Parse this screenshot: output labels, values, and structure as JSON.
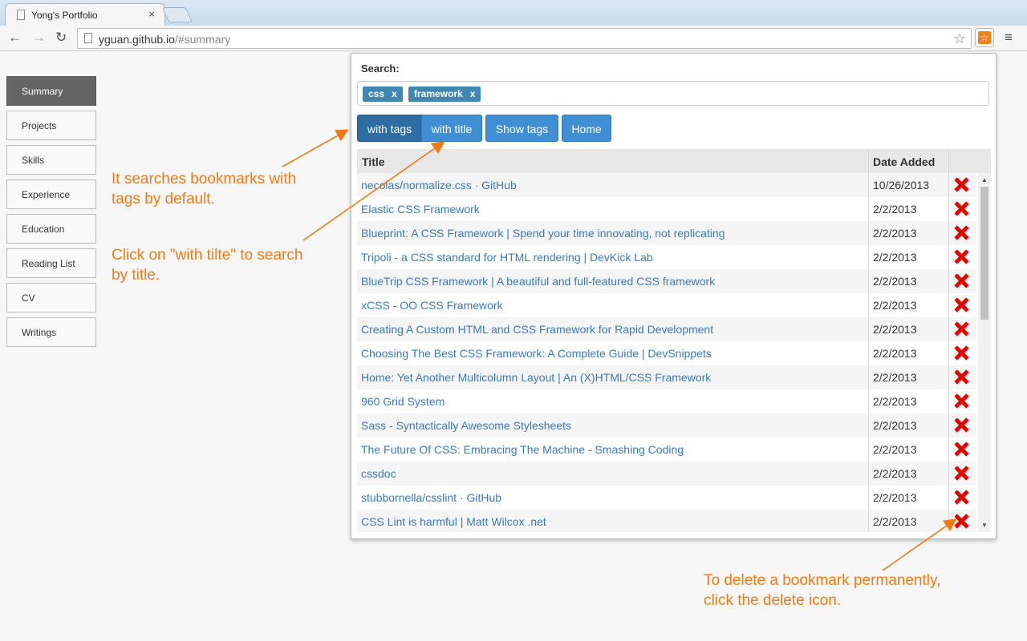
{
  "browser": {
    "tab_title": "Yong's Portfolio",
    "tab_close": "×",
    "url_host": "yguan.github.io",
    "url_path": "/#summary",
    "ext_icon": "☆",
    "menu_glyph": "≡"
  },
  "sidenav": {
    "items": [
      "Summary",
      "Projects",
      "Skills",
      "Experience",
      "Education",
      "Reading List",
      "CV",
      "Writings"
    ]
  },
  "annotations": {
    "note1": [
      "It searches bookmarks with",
      "tags by default."
    ],
    "note2": [
      "Click on \"with tilte\" to search",
      "by title."
    ],
    "note3": [
      "To delete a bookmark permanently,",
      "click the delete icon."
    ],
    "color": "#f07b15"
  },
  "popup": {
    "search_label": "Search:",
    "tags": [
      {
        "label": "css",
        "remove": "x"
      },
      {
        "label": "framework",
        "remove": "x"
      }
    ],
    "buttons": {
      "with_tags": "with tags",
      "with_title": "with title",
      "show_tags": "Show tags",
      "home": "Home"
    },
    "table": {
      "col_title": "Title",
      "col_date": "Date Added",
      "rows": [
        {
          "title": "necolas/normalize.css · GitHub",
          "date": "10/26/2013"
        },
        {
          "title": "Elastic CSS Framework",
          "date": "2/2/2013"
        },
        {
          "title": "Blueprint: A CSS Framework | Spend your time innovating, not replicating",
          "date": "2/2/2013"
        },
        {
          "title": "Tripoli - a CSS standard for HTML rendering | DevKick Lab",
          "date": "2/2/2013"
        },
        {
          "title": "BlueTrip CSS Framework | A beautiful and full-featured CSS framework",
          "date": "2/2/2013"
        },
        {
          "title": "xCSS - OO CSS Framework",
          "date": "2/2/2013"
        },
        {
          "title": "Creating A Custom HTML and CSS Framework for Rapid Development",
          "date": "2/2/2013"
        },
        {
          "title": "Choosing The Best CSS Framework: A Complete Guide | DevSnippets",
          "date": "2/2/2013"
        },
        {
          "title": "Home: Yet Another Multicolumn Layout | An (X)HTML/CSS Framework",
          "date": "2/2/2013"
        },
        {
          "title": "960 Grid System",
          "date": "2/2/2013"
        },
        {
          "title": "Sass - Syntactically Awesome Stylesheets",
          "date": "2/2/2013"
        },
        {
          "title": "The Future Of CSS: Embracing The Machine - Smashing Coding",
          "date": "2/2/2013"
        },
        {
          "title": "cssdoc",
          "date": "2/2/2013"
        },
        {
          "title": "stubbornella/csslint · GitHub",
          "date": "2/2/2013"
        },
        {
          "title": "CSS Lint is harmful | Matt Wilcox .net",
          "date": "2/2/2013"
        }
      ]
    }
  }
}
